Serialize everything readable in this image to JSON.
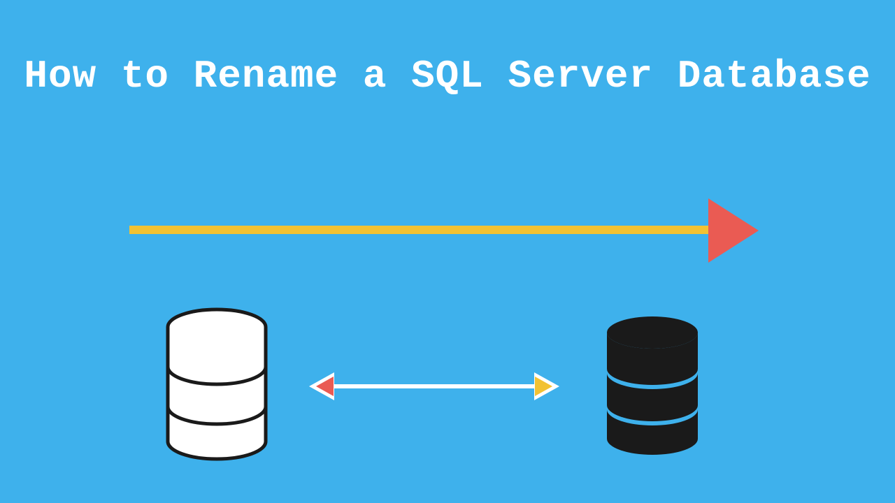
{
  "title": "How to Rename a SQL Server Database",
  "colors": {
    "background": "#3eb1ec",
    "text": "#ffffff",
    "arrow_line": "#f2c233",
    "arrow_head": "#ea5b53",
    "db_left_fill": "#ffffff",
    "db_left_stroke": "#1a1a1a",
    "db_right_fill": "#1a1a1a",
    "double_arrow_left_fill": "#ea5b53",
    "double_arrow_right_fill": "#f2c233"
  },
  "icons": {
    "left_database": "database-icon",
    "right_database": "database-icon",
    "main_arrow": "right-arrow",
    "connector": "double-arrow"
  }
}
